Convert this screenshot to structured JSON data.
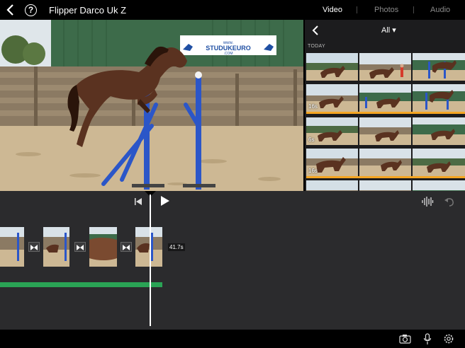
{
  "header": {
    "back_icon": "chevron-left-icon",
    "help_label": "?",
    "project_title": "Flipper Darco Uk Z",
    "tabs": [
      {
        "label": "Video",
        "active": true
      },
      {
        "label": "Photos",
        "active": false
      },
      {
        "label": "Audio",
        "active": false
      }
    ]
  },
  "viewer": {
    "banner_line1": "www.",
    "banner_line2": "STUDUKEURO",
    "banner_line3": ".COM"
  },
  "browser": {
    "filter_label": "All ▾",
    "section_label": "TODAY",
    "durations": [
      "16s",
      "6s",
      "16s"
    ]
  },
  "timeline": {
    "clip_duration": "41.7s",
    "audio_color": "#2aa355"
  },
  "toolbar": {
    "camera_icon": "camera-icon",
    "mic_icon": "microphone-icon",
    "settings_icon": "gear-icon"
  },
  "colors": {
    "accent_selection": "#f5a623",
    "tab_inactive": "#8a8a8a",
    "timeline_bg": "#2b2b2d",
    "jump_blue": "#2b56c8"
  }
}
